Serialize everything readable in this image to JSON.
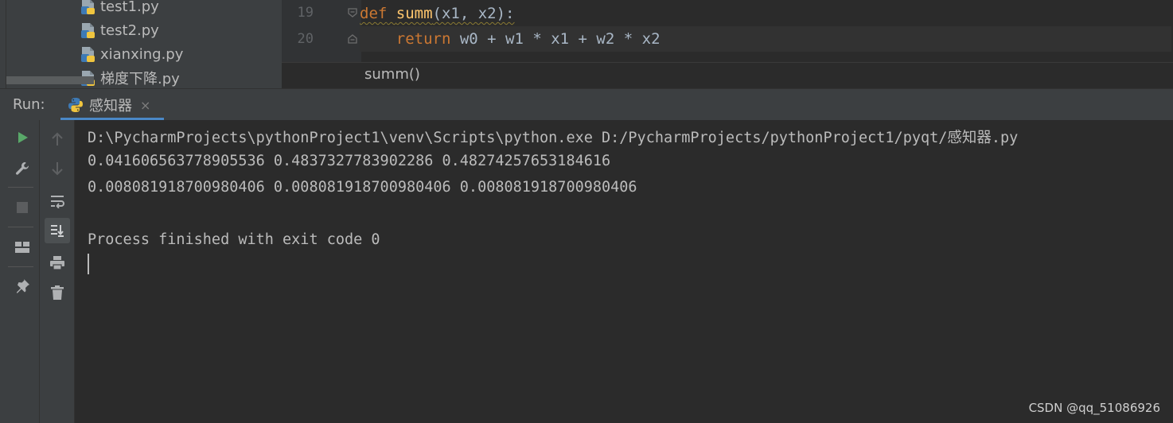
{
  "project_tree": {
    "items": [
      {
        "label": "test1.py"
      },
      {
        "label": "test2.py"
      },
      {
        "label": "xianxing.py"
      },
      {
        "label": "梯度下降.py"
      }
    ]
  },
  "editor": {
    "lines": [
      {
        "number": "19",
        "tokens": {
          "kw": "def",
          "name": "summ",
          "rest": "(x1, x2):"
        }
      },
      {
        "number": "20",
        "tokens": {
          "kw": "return",
          "rest": " w0 + w1 * x1 + w2 * x2"
        }
      }
    ],
    "breadcrumb": "summ()"
  },
  "run_window": {
    "label": "Run:",
    "tab_label": "感知器",
    "tab_close": "×"
  },
  "console": {
    "lines": [
      "D:\\PycharmProjects\\pythonProject1\\venv\\Scripts\\python.exe D:/PycharmProjects/pythonProject1/pyqt/感知器.py",
      "0.041606563778905536 0.4837327783902286 0.48274257653184616",
      "0.00808191870098040​6 0.008081918700980406 0.008081918700980406",
      "",
      "Process finished with exit code 0"
    ]
  },
  "watermark": "CSDN @qq_51086926",
  "colors": {
    "background": "#2b2b2b",
    "panel": "#3c3f41",
    "keyword": "#cc7832",
    "function": "#ffc66d",
    "run_green": "#59a869",
    "tab_accent": "#4a88c7"
  }
}
